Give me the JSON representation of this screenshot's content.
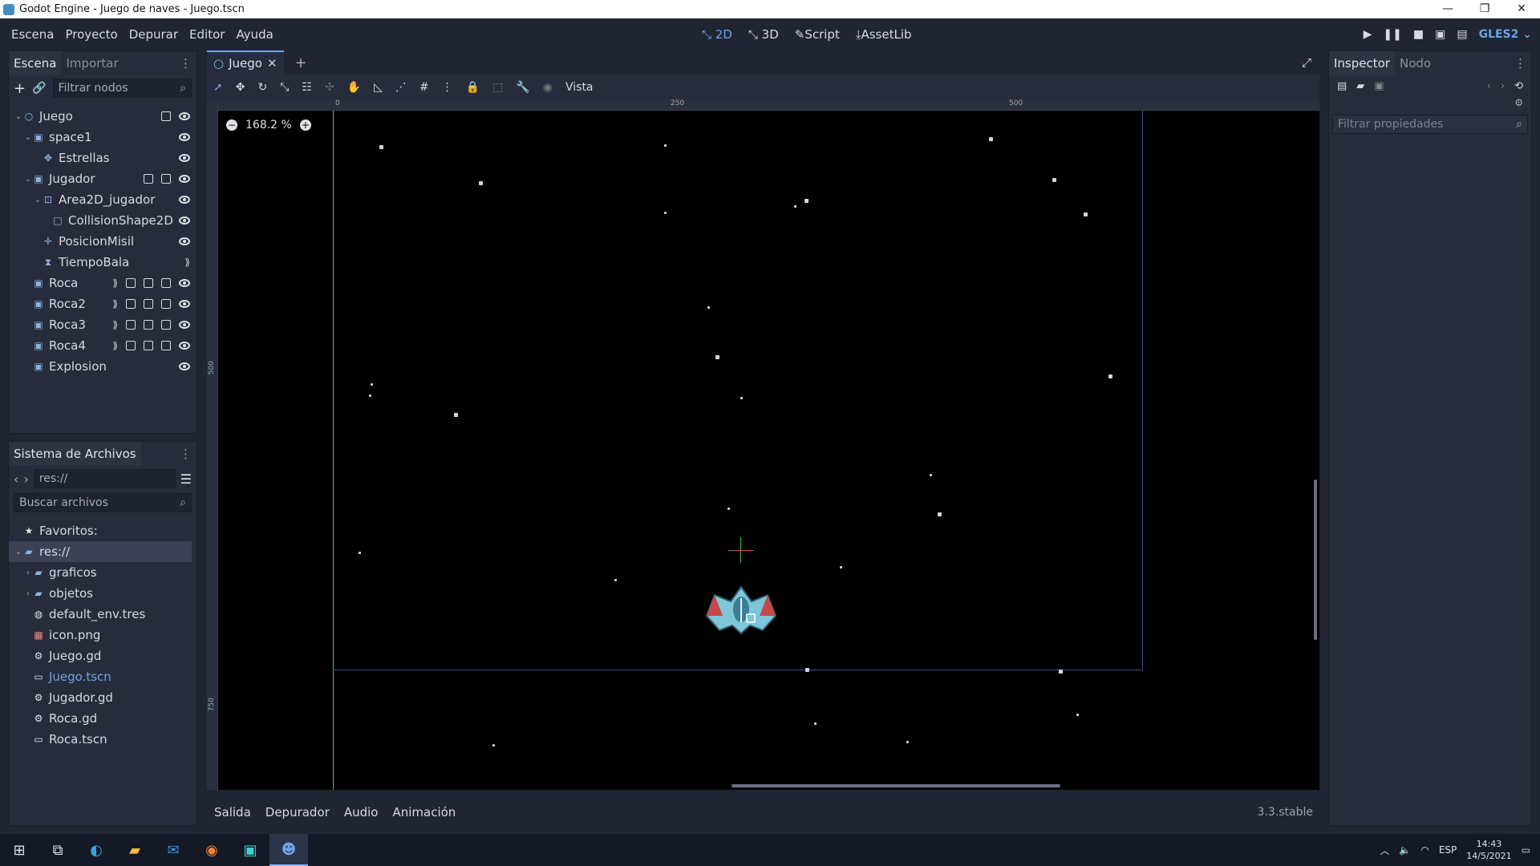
{
  "window": {
    "title": "Godot Engine - Juego de naves - Juego.tscn",
    "controls": [
      "—",
      "❐",
      "✕"
    ]
  },
  "menubar": {
    "items": [
      "Escena",
      "Proyecto",
      "Depurar",
      "Editor",
      "Ayuda"
    ],
    "workspaces": [
      "2D",
      "3D",
      "Script",
      "AssetLib"
    ],
    "renderer": "GLES2"
  },
  "scene_dock": {
    "tabs": [
      "Escena",
      "Importar"
    ],
    "filter_placeholder": "Filtrar nodos",
    "nodes": [
      {
        "label": "Juego",
        "icon": "node2d-icon"
      },
      {
        "label": "space1",
        "icon": "scene-instance-icon"
      },
      {
        "label": "Estrellas",
        "icon": "particles-icon"
      },
      {
        "label": "Jugador",
        "icon": "scene-instance-icon"
      },
      {
        "label": "Area2D_jugador",
        "icon": "area2d-icon"
      },
      {
        "label": "CollisionShape2D",
        "icon": "collision-shape-icon"
      },
      {
        "label": "PosicionMisil",
        "icon": "position2d-icon"
      },
      {
        "label": "TiempoBala",
        "icon": "timer-icon"
      },
      {
        "label": "Roca",
        "icon": "scene-instance-icon"
      },
      {
        "label": "Roca2",
        "icon": "scene-instance-icon"
      },
      {
        "label": "Roca3",
        "icon": "scene-instance-icon"
      },
      {
        "label": "Roca4",
        "icon": "scene-instance-icon"
      },
      {
        "label": "Explosion",
        "icon": "scene-instance-icon"
      }
    ]
  },
  "filesystem_dock": {
    "title": "Sistema de Archivos",
    "path": "res://",
    "search_placeholder": "Buscar archivos",
    "items": [
      {
        "label": "Favoritos:",
        "icon": "star-icon"
      },
      {
        "label": "res://",
        "icon": "folder-icon"
      },
      {
        "label": "graficos",
        "icon": "folder-icon"
      },
      {
        "label": "objetos",
        "icon": "folder-icon"
      },
      {
        "label": "default_env.tres",
        "icon": "environment-icon"
      },
      {
        "label": "icon.png",
        "icon": "image-icon"
      },
      {
        "label": "Juego.gd",
        "icon": "script-gear-icon"
      },
      {
        "label": "Juego.tscn",
        "icon": "scene-file-icon"
      },
      {
        "label": "Jugador.gd",
        "icon": "script-gear-icon"
      },
      {
        "label": "Roca.gd",
        "icon": "script-gear-icon"
      },
      {
        "label": "Roca.tscn",
        "icon": "scene-file-icon"
      }
    ]
  },
  "editor": {
    "scene_tab": "Juego",
    "zoom": "168.2 %",
    "view_menu": "Vista",
    "ruler_top": [
      "0",
      "250",
      "500"
    ],
    "ruler_left": [
      "500",
      "750"
    ]
  },
  "inspector": {
    "tabs": [
      "Inspector",
      "Nodo"
    ],
    "filter_placeholder": "Filtrar propiedades"
  },
  "bottom_panel": {
    "tabs": [
      "Salida",
      "Depurador",
      "Audio",
      "Animación"
    ],
    "version": "3.3.stable"
  },
  "taskbar": {
    "lang": "ESP",
    "time": "14:43",
    "date": "14/5/2021"
  }
}
